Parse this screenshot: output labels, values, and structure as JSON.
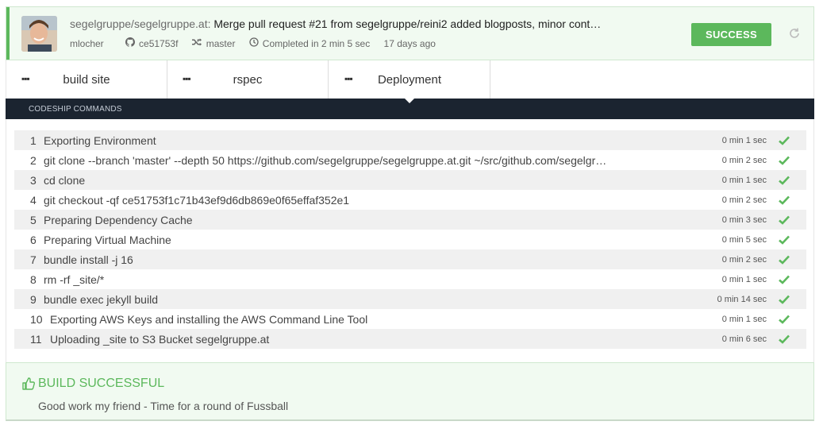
{
  "header": {
    "repo": "segelgruppe/segelgruppe.at:",
    "commit_message": "Merge pull request #21 from segelgruppe/reini2 added blogposts, minor cont…",
    "author": "mlocher",
    "commit_hash": "ce51753f",
    "branch": "master",
    "duration": "Completed in 2 min 5 sec",
    "ago": "17 days ago",
    "status_label": "SUCCESS",
    "status_color": "#5cb85c"
  },
  "tabs": [
    {
      "label": "build site"
    },
    {
      "label": "rspec"
    },
    {
      "label": "Deployment"
    }
  ],
  "commands_title": "CODESHIP COMMANDS",
  "commands": [
    {
      "num": "1",
      "text": "Exporting Environment",
      "duration": "0 min 1 sec"
    },
    {
      "num": "2",
      "text": "git clone --branch 'master' --depth 50 https://github.com/segelgruppe/segelgruppe.at.git ~/src/github.com/segelgr…",
      "duration": "0 min 2 sec"
    },
    {
      "num": "3",
      "text": "cd clone",
      "duration": "0 min 1 sec"
    },
    {
      "num": "4",
      "text": "git checkout -qf ce51753f1c71b43ef9d6db869e0f65effaf352e1",
      "duration": "0 min 2 sec"
    },
    {
      "num": "5",
      "text": "Preparing Dependency Cache",
      "duration": "0 min 3 sec"
    },
    {
      "num": "6",
      "text": "Preparing Virtual Machine",
      "duration": "0 min 5 sec"
    },
    {
      "num": "7",
      "text": "bundle install -j 16",
      "duration": "0 min 2 sec"
    },
    {
      "num": "8",
      "text": "rm -rf _site/*",
      "duration": "0 min 1 sec"
    },
    {
      "num": "9",
      "text": "bundle exec jekyll build",
      "duration": "0 min 14 sec"
    },
    {
      "num": "10",
      "text": "Exporting AWS Keys and installing the AWS Command Line Tool",
      "duration": "0 min 1 sec"
    },
    {
      "num": "11",
      "text": "Uploading _site to S3 Bucket segelgruppe.at",
      "duration": "0 min 6 sec"
    }
  ],
  "footer": {
    "status": "BUILD SUCCESSFUL",
    "message": "Good work my friend - Time for a round of Fussball"
  },
  "icons": {
    "github": "github-icon",
    "branch": "branch-icon",
    "clock": "clock-icon",
    "refresh": "refresh-icon",
    "check": "check-icon",
    "thumbs_up": "thumbs-up-icon",
    "menu": "ellipsis-icon"
  }
}
